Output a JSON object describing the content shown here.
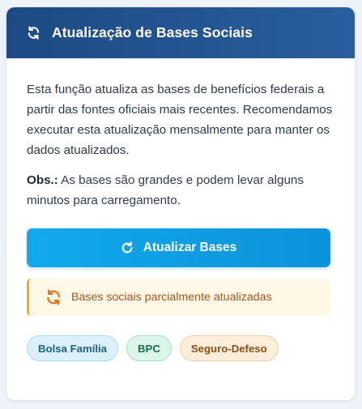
{
  "header": {
    "title": "Atualização de Bases Sociais",
    "icon": "sync-icon"
  },
  "body": {
    "description": "Esta função atualiza as bases de benefícios federais a partir das fontes oficiais mais recentes. Recomendamos executar esta atualização mensalmente para manter os dados atualizados.",
    "obs_label": "Obs.:",
    "obs_text": " As bases são grandes e podem levar alguns minutos para carregamento."
  },
  "update_button": {
    "label": "Atualizar Bases",
    "icon": "redo-icon"
  },
  "status": {
    "text": "Bases sociais parcialmente atualizadas",
    "icon": "sync-icon",
    "color": "#f1ac1e"
  },
  "badges": [
    {
      "label": "Bolsa Família",
      "color": "#1e5f86"
    },
    {
      "label": "BPC",
      "color": "#1c6b4b"
    },
    {
      "label": "Seguro-Defeso",
      "color": "#8a4f19"
    }
  ],
  "colors": {
    "header_bg": "#1d4a84",
    "button_bg": "#12a9ec",
    "status_bg": "#fff8e6"
  }
}
